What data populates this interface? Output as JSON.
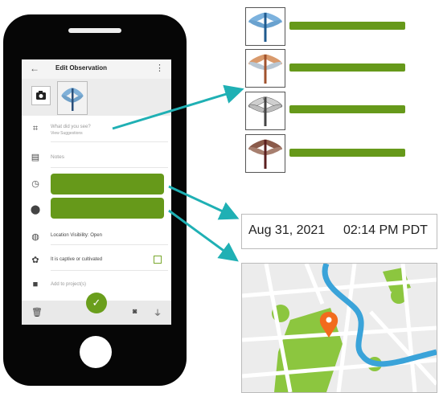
{
  "phone": {
    "screen": {
      "title": "Edit Observation",
      "what_label": "What did you see?",
      "what_sub": "View Suggestions",
      "notes": "Notes",
      "location_visibility": "Location Visibility: Open",
      "captive": "It is captive or cultivated",
      "add_project": "Add to project(s)"
    }
  },
  "date_display": {
    "date": "Aug 31, 2021",
    "time": "02:14 PM PDT"
  },
  "colors": {
    "brand_green": "#66991a",
    "arrow_teal": "#1fb0b4",
    "map_park": "#8cc63f",
    "map_river": "#3aa3d9",
    "pin": "#f26b1d"
  }
}
